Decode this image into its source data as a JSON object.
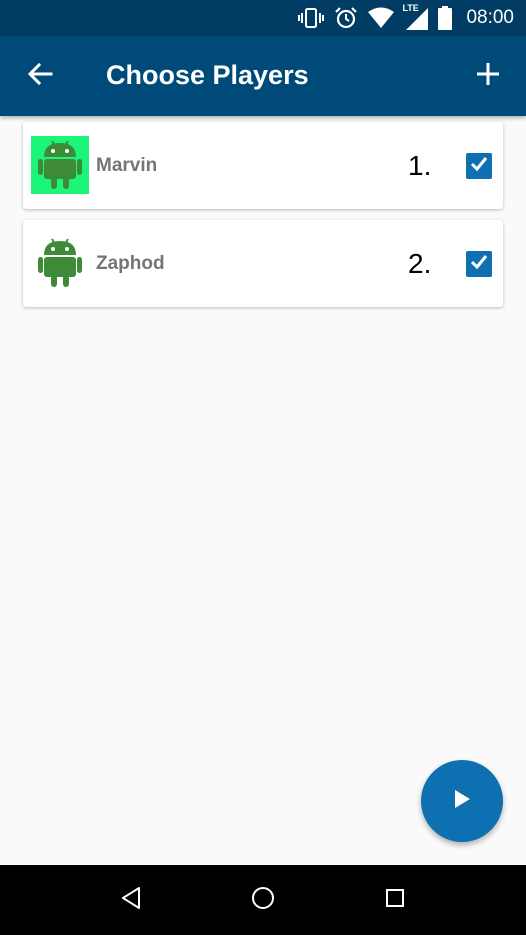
{
  "status_bar": {
    "time": "08:00",
    "network_label": "LTE",
    "icons": [
      "vibrate-icon",
      "alarm-icon",
      "wifi-icon",
      "lte-signal-icon",
      "battery-icon"
    ]
  },
  "app_bar": {
    "title": "Choose Players",
    "back_icon": "arrow-back-icon",
    "add_icon": "plus-icon"
  },
  "players": [
    {
      "name": "Marvin",
      "order": "1.",
      "checked": true,
      "highlighted": true,
      "avatar_icon": "android-icon"
    },
    {
      "name": "Zaphod",
      "order": "2.",
      "checked": true,
      "highlighted": false,
      "avatar_icon": "android-icon"
    }
  ],
  "fab": {
    "icon": "play-icon"
  },
  "nav_bar": {
    "icons": [
      "nav-back-icon",
      "nav-home-icon",
      "nav-recents-icon"
    ]
  },
  "colors": {
    "status_bar": "#003c63",
    "app_bar": "#004a79",
    "accent": "#0e70b0",
    "avatar_highlight": "#1cf57a",
    "android_green": "#3d8b37"
  }
}
